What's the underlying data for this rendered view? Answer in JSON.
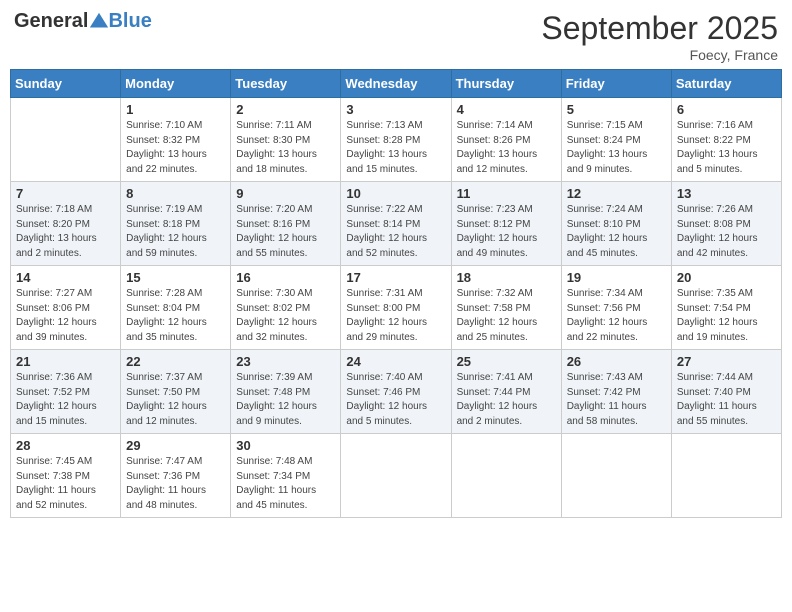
{
  "header": {
    "logo_general": "General",
    "logo_blue": "Blue",
    "title": "September 2025",
    "subtitle": "Foecy, France"
  },
  "days_of_week": [
    "Sunday",
    "Monday",
    "Tuesday",
    "Wednesday",
    "Thursday",
    "Friday",
    "Saturday"
  ],
  "weeks": [
    [
      {
        "day": "",
        "sunrise": "",
        "sunset": "",
        "daylight": ""
      },
      {
        "day": "1",
        "sunrise": "Sunrise: 7:10 AM",
        "sunset": "Sunset: 8:32 PM",
        "daylight": "Daylight: 13 hours and 22 minutes."
      },
      {
        "day": "2",
        "sunrise": "Sunrise: 7:11 AM",
        "sunset": "Sunset: 8:30 PM",
        "daylight": "Daylight: 13 hours and 18 minutes."
      },
      {
        "day": "3",
        "sunrise": "Sunrise: 7:13 AM",
        "sunset": "Sunset: 8:28 PM",
        "daylight": "Daylight: 13 hours and 15 minutes."
      },
      {
        "day": "4",
        "sunrise": "Sunrise: 7:14 AM",
        "sunset": "Sunset: 8:26 PM",
        "daylight": "Daylight: 13 hours and 12 minutes."
      },
      {
        "day": "5",
        "sunrise": "Sunrise: 7:15 AM",
        "sunset": "Sunset: 8:24 PM",
        "daylight": "Daylight: 13 hours and 9 minutes."
      },
      {
        "day": "6",
        "sunrise": "Sunrise: 7:16 AM",
        "sunset": "Sunset: 8:22 PM",
        "daylight": "Daylight: 13 hours and 5 minutes."
      }
    ],
    [
      {
        "day": "7",
        "sunrise": "Sunrise: 7:18 AM",
        "sunset": "Sunset: 8:20 PM",
        "daylight": "Daylight: 13 hours and 2 minutes."
      },
      {
        "day": "8",
        "sunrise": "Sunrise: 7:19 AM",
        "sunset": "Sunset: 8:18 PM",
        "daylight": "Daylight: 12 hours and 59 minutes."
      },
      {
        "day": "9",
        "sunrise": "Sunrise: 7:20 AM",
        "sunset": "Sunset: 8:16 PM",
        "daylight": "Daylight: 12 hours and 55 minutes."
      },
      {
        "day": "10",
        "sunrise": "Sunrise: 7:22 AM",
        "sunset": "Sunset: 8:14 PM",
        "daylight": "Daylight: 12 hours and 52 minutes."
      },
      {
        "day": "11",
        "sunrise": "Sunrise: 7:23 AM",
        "sunset": "Sunset: 8:12 PM",
        "daylight": "Daylight: 12 hours and 49 minutes."
      },
      {
        "day": "12",
        "sunrise": "Sunrise: 7:24 AM",
        "sunset": "Sunset: 8:10 PM",
        "daylight": "Daylight: 12 hours and 45 minutes."
      },
      {
        "day": "13",
        "sunrise": "Sunrise: 7:26 AM",
        "sunset": "Sunset: 8:08 PM",
        "daylight": "Daylight: 12 hours and 42 minutes."
      }
    ],
    [
      {
        "day": "14",
        "sunrise": "Sunrise: 7:27 AM",
        "sunset": "Sunset: 8:06 PM",
        "daylight": "Daylight: 12 hours and 39 minutes."
      },
      {
        "day": "15",
        "sunrise": "Sunrise: 7:28 AM",
        "sunset": "Sunset: 8:04 PM",
        "daylight": "Daylight: 12 hours and 35 minutes."
      },
      {
        "day": "16",
        "sunrise": "Sunrise: 7:30 AM",
        "sunset": "Sunset: 8:02 PM",
        "daylight": "Daylight: 12 hours and 32 minutes."
      },
      {
        "day": "17",
        "sunrise": "Sunrise: 7:31 AM",
        "sunset": "Sunset: 8:00 PM",
        "daylight": "Daylight: 12 hours and 29 minutes."
      },
      {
        "day": "18",
        "sunrise": "Sunrise: 7:32 AM",
        "sunset": "Sunset: 7:58 PM",
        "daylight": "Daylight: 12 hours and 25 minutes."
      },
      {
        "day": "19",
        "sunrise": "Sunrise: 7:34 AM",
        "sunset": "Sunset: 7:56 PM",
        "daylight": "Daylight: 12 hours and 22 minutes."
      },
      {
        "day": "20",
        "sunrise": "Sunrise: 7:35 AM",
        "sunset": "Sunset: 7:54 PM",
        "daylight": "Daylight: 12 hours and 19 minutes."
      }
    ],
    [
      {
        "day": "21",
        "sunrise": "Sunrise: 7:36 AM",
        "sunset": "Sunset: 7:52 PM",
        "daylight": "Daylight: 12 hours and 15 minutes."
      },
      {
        "day": "22",
        "sunrise": "Sunrise: 7:37 AM",
        "sunset": "Sunset: 7:50 PM",
        "daylight": "Daylight: 12 hours and 12 minutes."
      },
      {
        "day": "23",
        "sunrise": "Sunrise: 7:39 AM",
        "sunset": "Sunset: 7:48 PM",
        "daylight": "Daylight: 12 hours and 9 minutes."
      },
      {
        "day": "24",
        "sunrise": "Sunrise: 7:40 AM",
        "sunset": "Sunset: 7:46 PM",
        "daylight": "Daylight: 12 hours and 5 minutes."
      },
      {
        "day": "25",
        "sunrise": "Sunrise: 7:41 AM",
        "sunset": "Sunset: 7:44 PM",
        "daylight": "Daylight: 12 hours and 2 minutes."
      },
      {
        "day": "26",
        "sunrise": "Sunrise: 7:43 AM",
        "sunset": "Sunset: 7:42 PM",
        "daylight": "Daylight: 11 hours and 58 minutes."
      },
      {
        "day": "27",
        "sunrise": "Sunrise: 7:44 AM",
        "sunset": "Sunset: 7:40 PM",
        "daylight": "Daylight: 11 hours and 55 minutes."
      }
    ],
    [
      {
        "day": "28",
        "sunrise": "Sunrise: 7:45 AM",
        "sunset": "Sunset: 7:38 PM",
        "daylight": "Daylight: 11 hours and 52 minutes."
      },
      {
        "day": "29",
        "sunrise": "Sunrise: 7:47 AM",
        "sunset": "Sunset: 7:36 PM",
        "daylight": "Daylight: 11 hours and 48 minutes."
      },
      {
        "day": "30",
        "sunrise": "Sunrise: 7:48 AM",
        "sunset": "Sunset: 7:34 PM",
        "daylight": "Daylight: 11 hours and 45 minutes."
      },
      {
        "day": "",
        "sunrise": "",
        "sunset": "",
        "daylight": ""
      },
      {
        "day": "",
        "sunrise": "",
        "sunset": "",
        "daylight": ""
      },
      {
        "day": "",
        "sunrise": "",
        "sunset": "",
        "daylight": ""
      },
      {
        "day": "",
        "sunrise": "",
        "sunset": "",
        "daylight": ""
      }
    ]
  ]
}
